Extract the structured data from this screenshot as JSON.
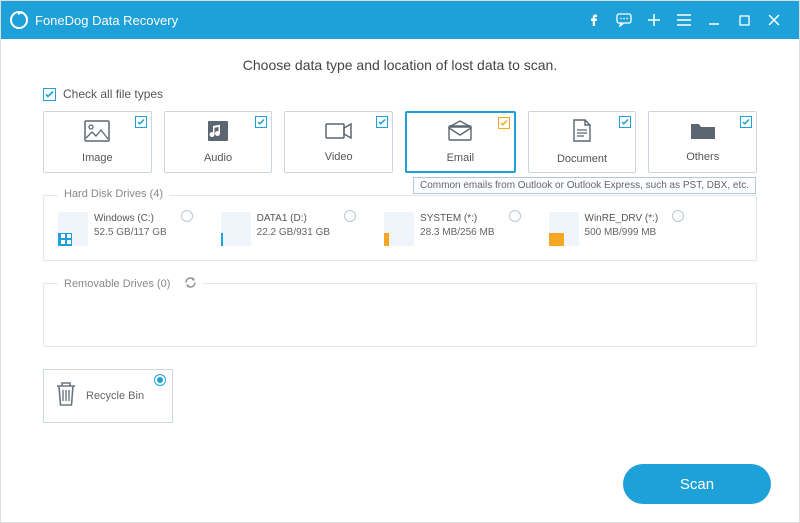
{
  "app": {
    "title": "FoneDog Data Recovery"
  },
  "heading": "Choose data type and location of lost data to scan.",
  "checkAllLabel": "Check all file types",
  "types": [
    {
      "key": "image",
      "label": "Image"
    },
    {
      "key": "audio",
      "label": "Audio"
    },
    {
      "key": "video",
      "label": "Video"
    },
    {
      "key": "email",
      "label": "Email",
      "selected": true
    },
    {
      "key": "document",
      "label": "Document"
    },
    {
      "key": "others",
      "label": "Others"
    }
  ],
  "tooltip": "Common emails from Outlook or Outlook Express, such as PST, DBX, etc.",
  "hardDisk": {
    "legend": "Hard Disk Drives (4)",
    "drives": [
      {
        "name": "Windows (C:)",
        "size": "52.5 GB/117 GB",
        "color": "#1ea0d9",
        "fill": 0.45,
        "logo": true
      },
      {
        "name": "DATA1 (D:)",
        "size": "22.2 GB/931 GB",
        "color": "#1ea0d9",
        "fill": 0.05
      },
      {
        "name": "SYSTEM (*:)",
        "size": "28.3 MB/256 MB",
        "color": "#f5a623",
        "fill": 0.15
      },
      {
        "name": "WinRE_DRV (*:)",
        "size": "500 MB/999 MB",
        "color": "#f5a623",
        "fill": 0.5
      }
    ]
  },
  "removable": {
    "legend": "Removable Drives (0)"
  },
  "recycle": {
    "label": "Recycle Bin",
    "selected": true
  },
  "scanLabel": "Scan"
}
